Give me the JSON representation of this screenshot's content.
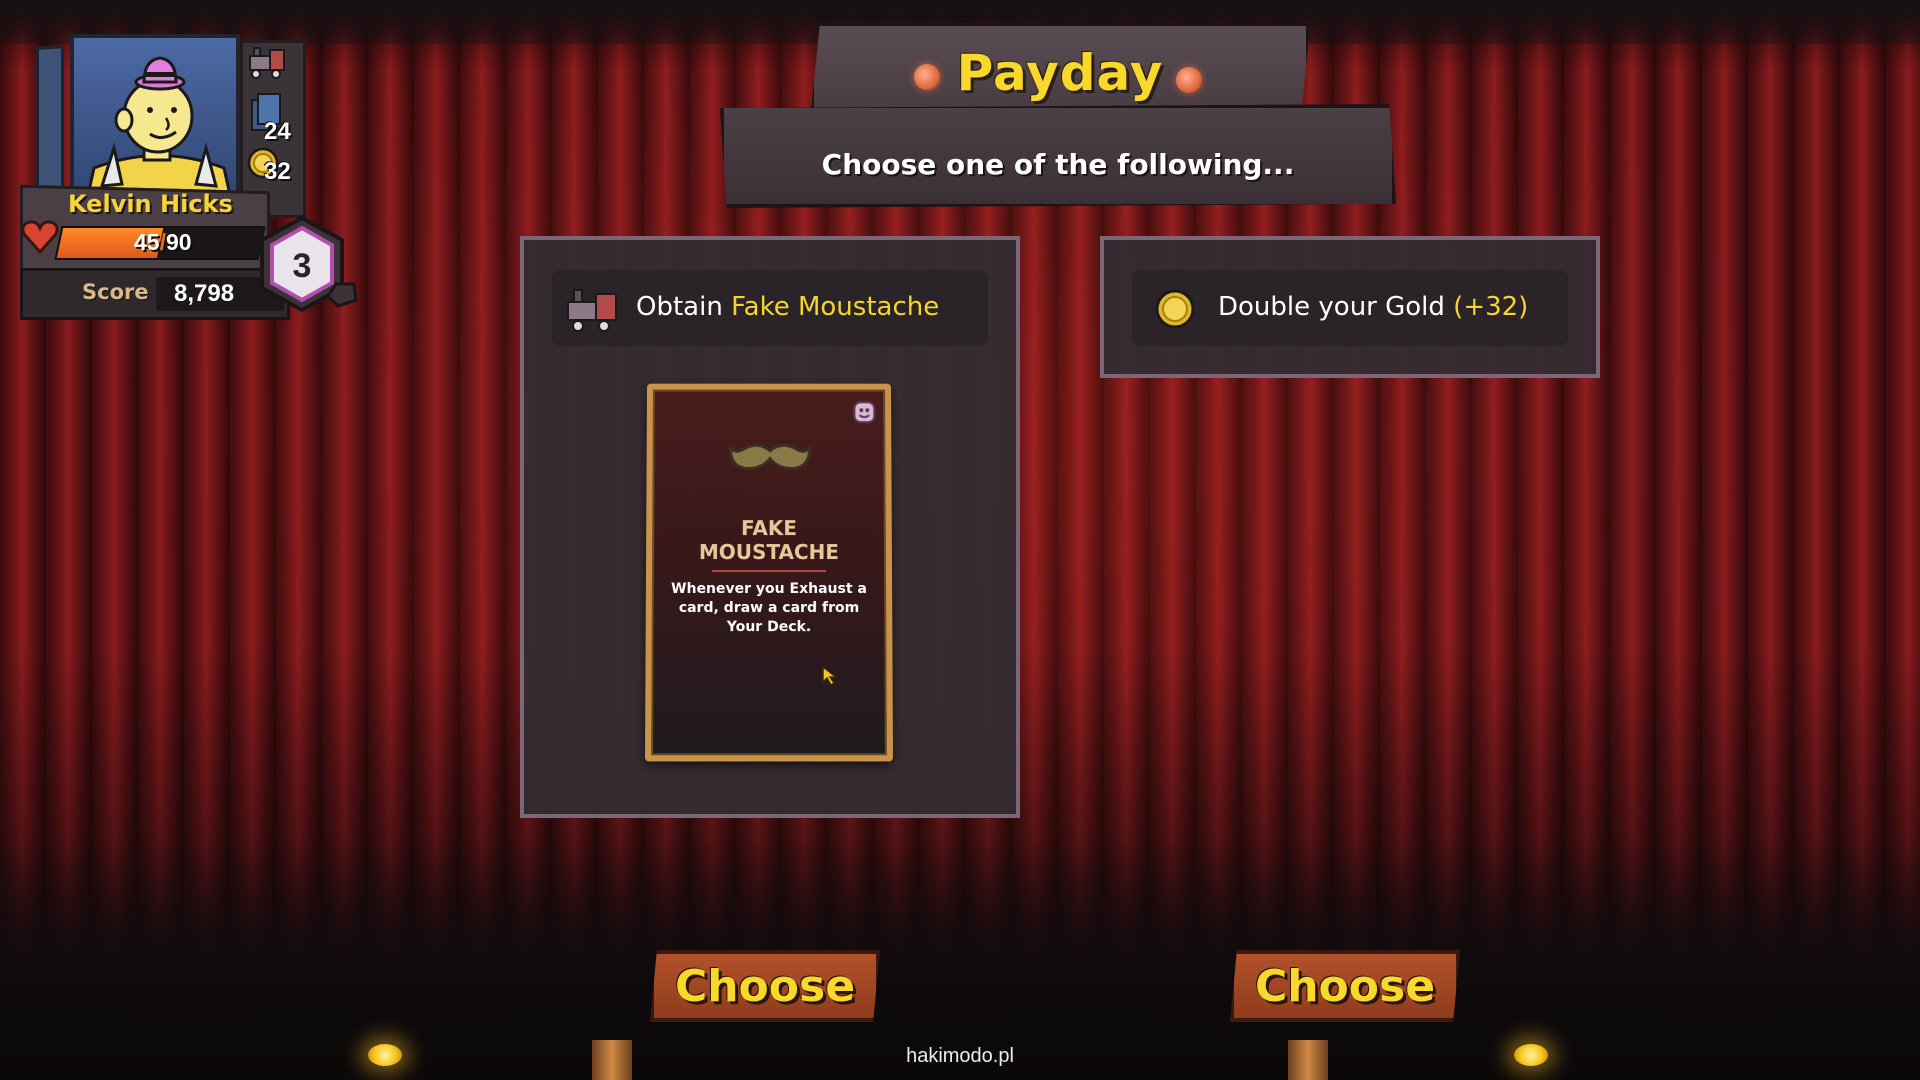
{
  "event": {
    "title": "Payday",
    "subtitle": "Choose one of the following..."
  },
  "player": {
    "name": "Kelvin Hicks",
    "hp_current": "45",
    "hp_max": "90",
    "hp_separator": "/",
    "hp_fraction": 0.5,
    "level": "3",
    "score_label": "Score",
    "score": "8,798",
    "deck_count": "24",
    "gold": "32"
  },
  "options": [
    {
      "prefix": "Obtain ",
      "highlight": "Fake Moustache",
      "icon": "train-relic-icon",
      "button_label": "Choose",
      "card": {
        "name_line1": "FAKE",
        "name_line2": "MOUSTACHE",
        "description": "Whenever you Exhaust a card, draw a card from Your Deck.",
        "icon": "moustache-icon"
      }
    },
    {
      "prefix": "Double your Gold ",
      "highlight": "(+32)",
      "icon": "gold-coin-icon",
      "button_label": "Choose"
    }
  ],
  "watermark": "hakimodo.pl",
  "colors": {
    "accent_yellow": "#f7d82b",
    "button": "#a4482a",
    "panel_border": "#7c6677",
    "hp_fill": "#f26a21"
  }
}
